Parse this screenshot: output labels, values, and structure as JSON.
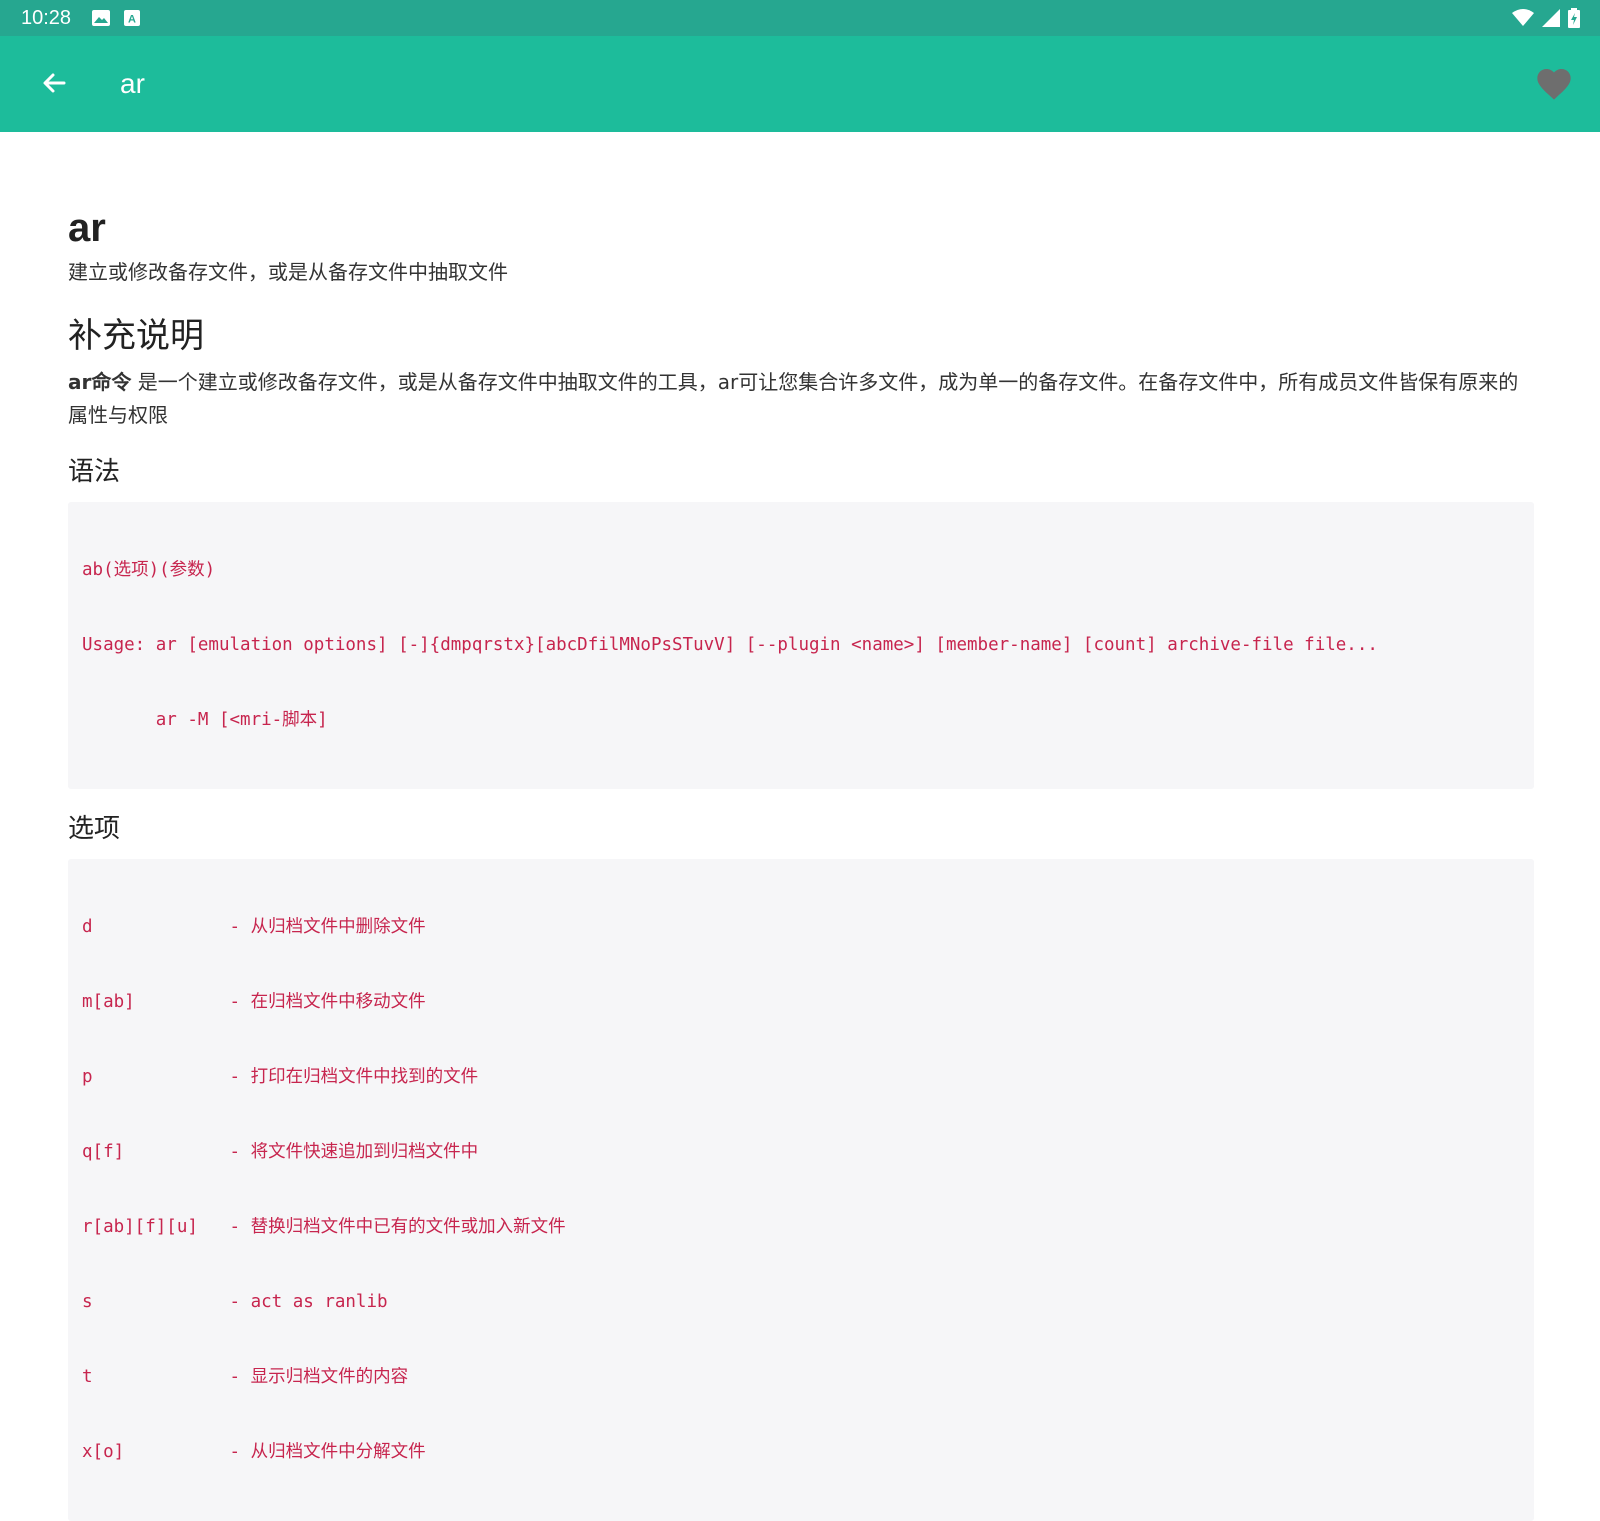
{
  "status": {
    "time": "10:28",
    "left_icons": [
      "image-icon",
      "text-icon"
    ],
    "right_icons": [
      "wifi-icon",
      "signal-icon",
      "battery-icon"
    ]
  },
  "appbar": {
    "title": "ar",
    "back_icon": "arrow-back-icon",
    "favorite_icon": "heart-icon"
  },
  "colors": {
    "status_bar": "#26a790",
    "app_bar": "#1dbc9b",
    "code_text": "#c7254e",
    "code_bg": "#f6f6f8"
  },
  "doc": {
    "title": "ar",
    "subtitle": "建立或修改备存文件，或是从备存文件中抽取文件",
    "section_more": "补充说明",
    "description_bold": "ar命令",
    "description_rest": " 是一个建立或修改备存文件，或是从备存文件中抽取文件的工具，ar可让您集合许多文件，成为单一的备存文件。在备存文件中，所有成员文件皆保有原来的属性与权限",
    "section_syntax": "语法",
    "syntax_lines": [
      "ab(选项)(参数)",
      "Usage: ar [emulation options] [-]{dmpqrstx}[abcDfilMNoPsSTuvV] [--plugin <name>] [member-name] [count] archive-file file...",
      "       ar -M [<mri-脚本]"
    ],
    "section_options": "选项",
    "option_lines": [
      "d             - 从归档文件中删除文件",
      "m[ab]         - 在归档文件中移动文件",
      "p             - 打印在归档文件中找到的文件",
      "q[f]          - 将文件快速追加到归档文件中",
      "r[ab][f][u]   - 替换归档文件中已有的文件或加入新文件",
      "s             - act as ranlib",
      "t             - 显示归档文件的内容",
      "x[o]          - 从归档文件中分解文件"
    ]
  }
}
